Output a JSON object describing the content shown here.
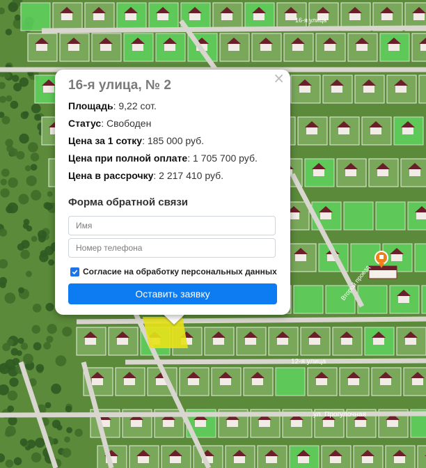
{
  "popup": {
    "title": "16-я улица, № 2",
    "close_symbol": "×",
    "rows": [
      {
        "label": "Площадь",
        "value": ": 9,22 сот."
      },
      {
        "label": "Статус",
        "value": ": Свободен"
      },
      {
        "label": "Цена за 1 сотку",
        "value": ": 185 000 руб."
      },
      {
        "label": "Цена при полной оплате",
        "value": ": 1 705 700 руб."
      },
      {
        "label": "Цена в рассрочку",
        "value": ": 2 217 410 руб."
      }
    ],
    "form": {
      "title": "Форма обратной связи",
      "name_placeholder": "Имя",
      "phone_placeholder": "Номер телефона",
      "consent_label": "Согласие на обработку персональных данных",
      "consent_checked": true,
      "submit_label": "Оставить заявку"
    }
  },
  "map": {
    "street_labels": [
      "16-я улица",
      "12-я улица",
      "ул. Прогулочная",
      "Второй проезд"
    ],
    "colors": {
      "grass": "#5b8a3a",
      "available_plot": "#5fd45f",
      "selected_plot": "#e7e21a",
      "road": "#d9d6cf",
      "roof": "#6b1f2a",
      "marker": "#f07f1a",
      "accent_button": "#0d7cf2"
    },
    "marker_icon": "map-pin-icon"
  }
}
